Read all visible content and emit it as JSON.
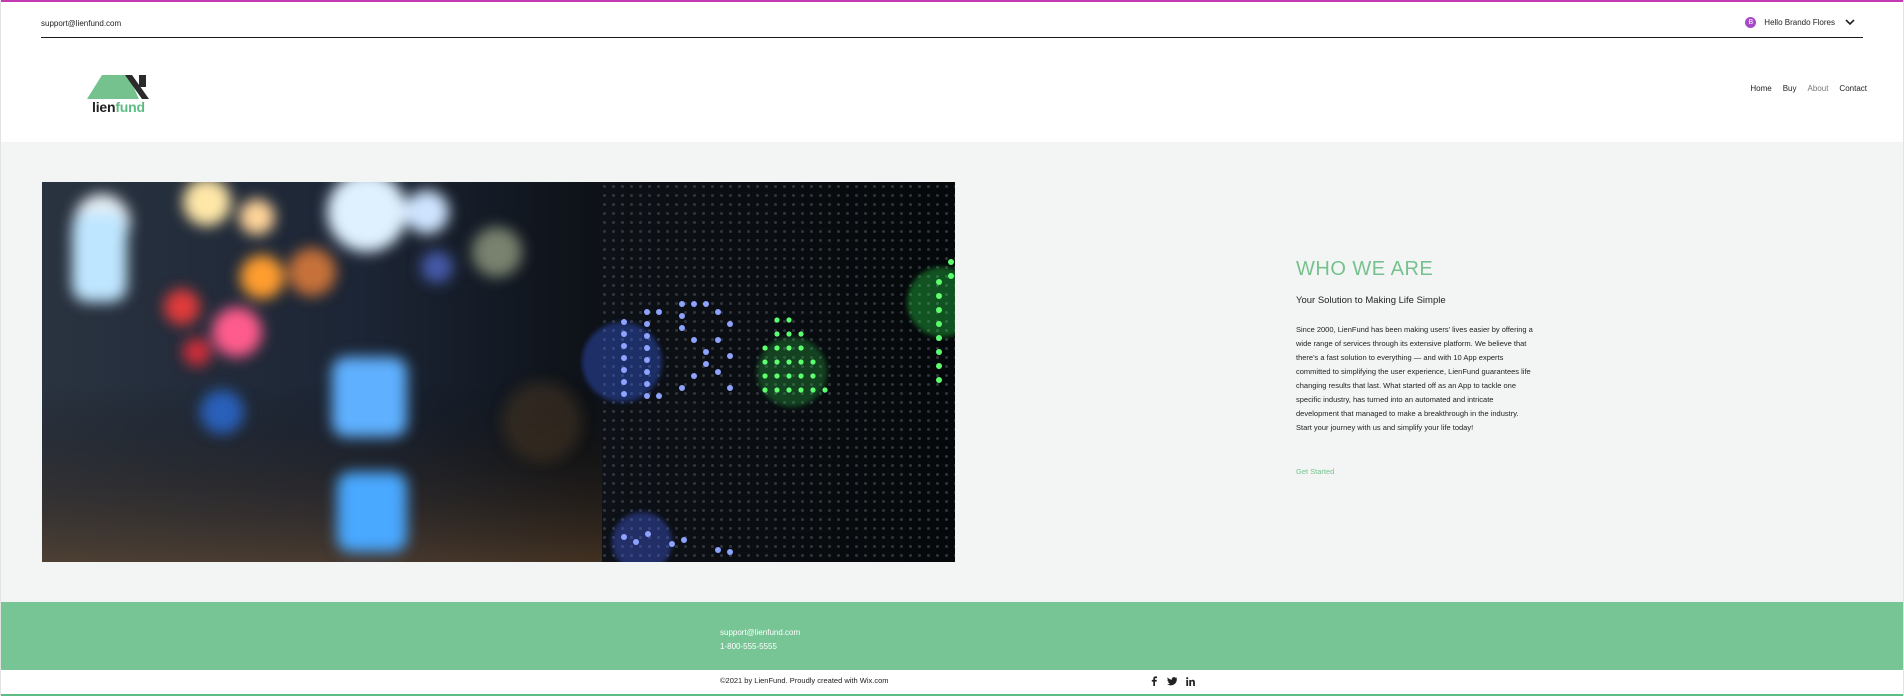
{
  "topbar": {
    "support_email": "support@lienfund.com",
    "user": {
      "avatar_initial": "B",
      "greeting": "Hello Brando Flores"
    }
  },
  "logo": {
    "text_part1": "lien",
    "text_part2": "fund"
  },
  "nav": {
    "items": [
      {
        "label": "Home"
      },
      {
        "label": "Buy"
      },
      {
        "label": "About",
        "active": true
      },
      {
        "label": "Contact"
      }
    ]
  },
  "about": {
    "heading": "WHO WE ARE",
    "subtitle": "Your Solution to Making Life Simple",
    "body": "Since 2000, LienFund has been making users' lives easier by offering a wide range of services through its extensive platform. We believe that there's a fast solution to everything — and with 10 App experts committed to simplifying the user experience, LienFund guarantees life changing results that last. What started off as an App to tackle one specific industry, has turned into an automated and intricate development that managed to make a breakthrough in the industry. Start your journey with us and simplify your life today!",
    "cta": "Get Started"
  },
  "footer": {
    "email": "support@lienfund.com",
    "phone": "1-800-555-5555",
    "copyright": "©2021 by LienFund. Proudly created with ",
    "copyright_link": "Wix.com"
  },
  "colors": {
    "accent": "#76c28f",
    "footer_bg": "#77c495",
    "top_line": "#c23bb2",
    "avatar": "#a54bc9"
  },
  "icons": [
    "chevron-down-icon",
    "facebook-icon",
    "twitter-icon",
    "linkedin-icon"
  ]
}
